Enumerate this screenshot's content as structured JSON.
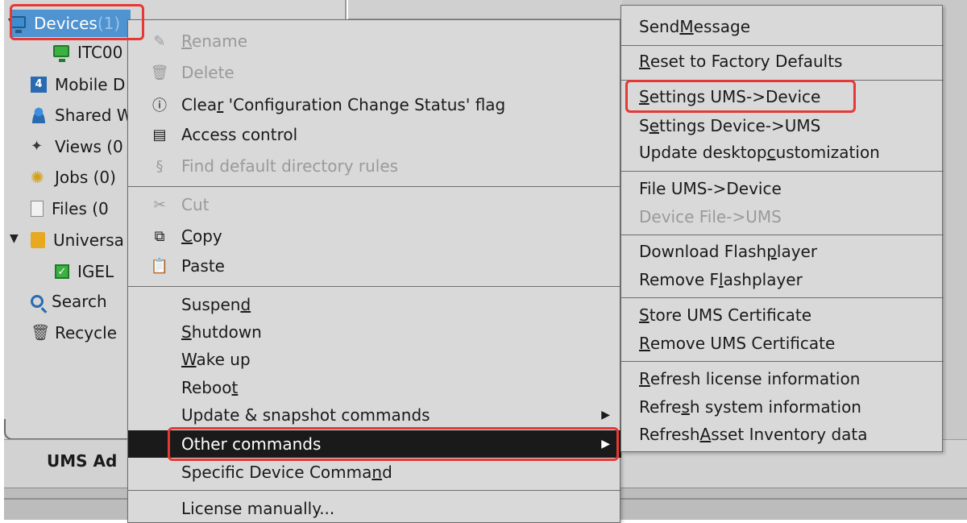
{
  "tree": {
    "items": [
      {
        "label": "Devices",
        "suffix": " (1)",
        "icon": "monitor-icon"
      },
      {
        "label": "ITC00",
        "icon": "monitor-green-icon"
      },
      {
        "label": "Mobile D",
        "icon": "mobile-icon"
      },
      {
        "label": "Shared W",
        "icon": "user-icon"
      },
      {
        "label": "Views (0",
        "icon": "views-icon"
      },
      {
        "label": "Jobs (0)",
        "icon": "jobs-icon"
      },
      {
        "label": "Files (0",
        "icon": "file-icon"
      },
      {
        "label": "Universa",
        "icon": "folder-icon"
      },
      {
        "label": "IGEL",
        "icon": "check-icon"
      },
      {
        "label": "Search",
        "icon": "search-icon"
      },
      {
        "label": "Recycle",
        "icon": "trash-icon"
      }
    ]
  },
  "status_label": "UMS Ad",
  "main_menu": {
    "items": [
      {
        "pre": "",
        "ul": "R",
        "post": "ename",
        "icon": "pencil-icon",
        "disabled": true
      },
      {
        "pre": "",
        "ul": "",
        "post": "Delete",
        "icon": "trash-icon",
        "disabled": true
      },
      {
        "pre": "Clea",
        "ul": "r",
        "post": " 'Configuration Change Status' flag",
        "icon": "alert-icon",
        "disabled": false
      },
      {
        "pre": "Access control",
        "ul": "",
        "post": "",
        "icon": "id-card-icon",
        "disabled": false
      },
      {
        "pre": "Find default directory rules",
        "ul": "",
        "post": "",
        "icon": "rules-icon",
        "disabled": true
      },
      {
        "pre": "Cut",
        "ul": "",
        "post": "",
        "icon": "scissors-icon",
        "disabled": true
      },
      {
        "pre": "",
        "ul": "C",
        "post": "opy",
        "icon": "copy-icon",
        "disabled": false
      },
      {
        "pre": "Paste",
        "ul": "",
        "post": "",
        "icon": "paste-icon",
        "disabled": false
      },
      {
        "pre": "Suspen",
        "ul": "d",
        "post": "",
        "icon": "",
        "disabled": false
      },
      {
        "pre": "",
        "ul": "S",
        "post": "hutdown",
        "icon": "",
        "disabled": false
      },
      {
        "pre": "",
        "ul": "W",
        "post": "ake up",
        "icon": "",
        "disabled": false
      },
      {
        "pre": "Reboo",
        "ul": "t",
        "post": "",
        "icon": "",
        "disabled": false
      },
      {
        "pre": "Update & snapshot commands",
        "ul": "",
        "post": "",
        "icon": "",
        "disabled": false,
        "submenu": true
      },
      {
        "pre": "Other commands",
        "ul": "",
        "post": "",
        "icon": "",
        "disabled": false,
        "submenu": true,
        "selected": true
      },
      {
        "pre": "Specific Device Comma",
        "ul": "n",
        "post": "d",
        "icon": "",
        "disabled": false
      },
      {
        "pre": "License manually...",
        "ul": "",
        "post": "",
        "icon": "",
        "disabled": false
      }
    ]
  },
  "sub_menu": {
    "items": [
      {
        "pre": "Send ",
        "ul": "M",
        "post": "essage",
        "disabled": false
      },
      {
        "pre": "",
        "ul": "R",
        "post": "eset to Factory Defaults",
        "disabled": false
      },
      {
        "pre": "",
        "ul": "S",
        "post": "ettings UMS->Device",
        "disabled": false
      },
      {
        "pre": "S",
        "ul": "e",
        "post": "ttings Device->UMS",
        "disabled": false
      },
      {
        "pre": "Update desktop ",
        "ul": "c",
        "post": "ustomization",
        "disabled": false
      },
      {
        "pre": "File UMS->Device",
        "ul": "",
        "post": "",
        "disabled": false
      },
      {
        "pre": "Device File->UMS",
        "ul": "",
        "post": "",
        "disabled": true
      },
      {
        "pre": "Download Flash",
        "ul": "p",
        "post": "layer",
        "disabled": false
      },
      {
        "pre": "Remove F",
        "ul": "l",
        "post": "ashplayer",
        "disabled": false
      },
      {
        "pre": "",
        "ul": "S",
        "post": "tore UMS Certificate",
        "disabled": false
      },
      {
        "pre": "",
        "ul": "R",
        "post": "emove UMS Certificate",
        "disabled": false
      },
      {
        "pre": "",
        "ul": "R",
        "post": "efresh license information",
        "disabled": false
      },
      {
        "pre": "Refre",
        "ul": "s",
        "post": "h system information",
        "disabled": false
      },
      {
        "pre": "Refresh ",
        "ul": "A",
        "post": "sset Inventory data",
        "disabled": false
      }
    ]
  },
  "colors": {
    "selection": "#4f93d1",
    "highlight_box": "#e53935",
    "menu_bg": "#d9d9d9",
    "menu_selected": "#1a1a1a"
  }
}
